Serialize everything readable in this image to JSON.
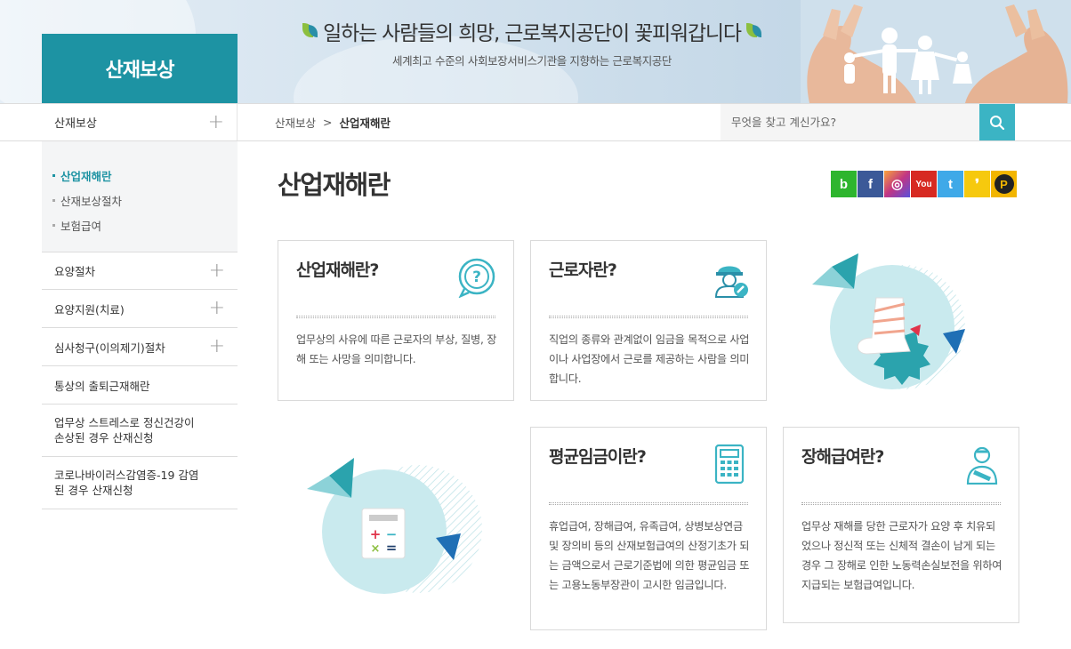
{
  "banner": {
    "section_title": "산재보상",
    "slogan": "일하는 사람들의 희망, 근로복지공단이 꽃피워갑니다",
    "slogan_sub": "세계최고 수준의 사회보장서비스기관을 지향하는 근로복지공단"
  },
  "nav": {
    "side_head": "산재보상",
    "breadcrumb": [
      "산재보상",
      "산업재해란"
    ],
    "search_placeholder": "무엇을 찾고 계신가요?"
  },
  "sidebar": {
    "submenu": [
      "산업재해란",
      "산재보상절차",
      "보험급여"
    ],
    "menus": [
      {
        "label": "요양절차",
        "expandable": true
      },
      {
        "label": "요양지원(치료)",
        "expandable": true
      },
      {
        "label": "심사청구(이의제기)절차",
        "expandable": true
      },
      {
        "label": "통상의 출퇴근재해란",
        "expandable": false
      },
      {
        "label": "업무상 스트레스로 정신건강이 손상된 경우 산재신청",
        "expandable": false
      },
      {
        "label": "코로나바이러스감염증-19 감염된 경우 산재신청",
        "expandable": false
      }
    ]
  },
  "main": {
    "title": "산업재해란",
    "social": [
      {
        "name": "blog",
        "glyph": "b",
        "color": "#2eb52e"
      },
      {
        "name": "facebook",
        "glyph": "f",
        "color": "#3b5998"
      },
      {
        "name": "instagram",
        "glyph": "◎",
        "color": "#b33aa5"
      },
      {
        "name": "youtube",
        "glyph": "You",
        "color": "#d72a22"
      },
      {
        "name": "twitter",
        "glyph": "t",
        "color": "#3fa9e8"
      },
      {
        "name": "kakaostory",
        "glyph": "❜",
        "color": "#f6c90e"
      },
      {
        "name": "kakaopage",
        "glyph": "P",
        "color": "#f2b500"
      }
    ],
    "cards": [
      {
        "title": "산업재해란?",
        "desc": "업무상의 사유에 따른 근로자의 부상, 질병, 장해 또는 사망을 의미합니다.",
        "icon": "question-bubble-icon"
      },
      {
        "title": "근로자란?",
        "desc": "직업의 종류와 관계없이 임금을 목적으로 사업이나 사업장에서 근로를 제공하는 사람을 의미합니다.",
        "icon": "worker-icon"
      },
      {
        "title": "평균임금이란?",
        "desc": "휴업급여, 장해급여, 유족급여, 상병보상연금 및 장의비 등의 산재보험급여의 산정기초가 되는 금액으로서 근로기준법에 의한 평균임금 또는 고용노동부장관이 고시한 임금입니다.",
        "icon": "calculator-icon"
      },
      {
        "title": "장해급여란?",
        "desc": "업무상 재해를 당한 근로자가 요양 후 치유되었으나 정신적 또는 신체적 결손이 남게 되는 경우 그 장해로 인한 노동력손실보전을 위하여 지급되는 보험급여입니다.",
        "icon": "injured-person-icon"
      }
    ]
  },
  "colors": {
    "accent": "#1d93a3",
    "search_button": "#3bb4c4"
  }
}
